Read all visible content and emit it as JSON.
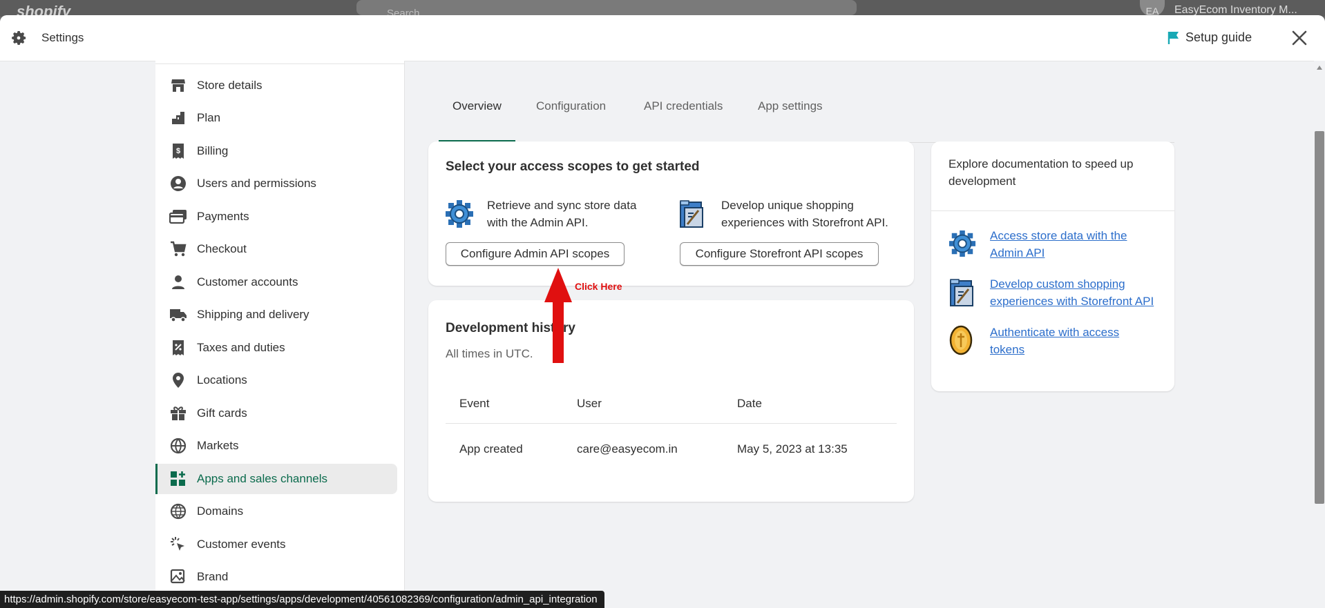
{
  "background": {
    "logo": "shopify",
    "search_placeholder": "Search",
    "avatar_initials": "EA",
    "store_name": "EasyEcom Inventory M..."
  },
  "header": {
    "title": "Settings",
    "setup_guide": "Setup guide"
  },
  "sidebar": {
    "items": [
      {
        "label": "Store details",
        "icon": "store-icon"
      },
      {
        "label": "Plan",
        "icon": "plan-icon"
      },
      {
        "label": "Billing",
        "icon": "billing-icon"
      },
      {
        "label": "Users and permissions",
        "icon": "user-circle-icon"
      },
      {
        "label": "Payments",
        "icon": "payments-icon"
      },
      {
        "label": "Checkout",
        "icon": "cart-icon"
      },
      {
        "label": "Customer accounts",
        "icon": "person-icon"
      },
      {
        "label": "Shipping and delivery",
        "icon": "truck-icon"
      },
      {
        "label": "Taxes and duties",
        "icon": "tax-icon"
      },
      {
        "label": "Locations",
        "icon": "location-pin-icon"
      },
      {
        "label": "Gift cards",
        "icon": "gift-icon"
      },
      {
        "label": "Markets",
        "icon": "markets-globe-icon"
      },
      {
        "label": "Apps and sales channels",
        "icon": "apps-icon",
        "active": true
      },
      {
        "label": "Domains",
        "icon": "globe-icon"
      },
      {
        "label": "Customer events",
        "icon": "cursor-click-icon"
      },
      {
        "label": "Brand",
        "icon": "brand-image-icon"
      }
    ]
  },
  "tabs": [
    {
      "label": "Overview",
      "active": true
    },
    {
      "label": "Configuration"
    },
    {
      "label": "API credentials"
    },
    {
      "label": "App settings"
    }
  ],
  "scopes": {
    "title": "Select your access scopes to get started",
    "admin_text_1": "Retrieve and sync store data",
    "admin_text_2": "with the Admin API.",
    "storefront_text_1": "Develop unique shopping",
    "storefront_text_2": "experiences with Storefront API.",
    "admin_button": "Configure Admin API scopes",
    "storefront_button": "Configure Storefront API scopes"
  },
  "annotation": {
    "label": "Click Here",
    "color": "#e01010"
  },
  "history": {
    "title": "Development history",
    "subtitle": "All times in UTC.",
    "columns": [
      "Event",
      "User",
      "Date"
    ],
    "rows": [
      {
        "event": "App created",
        "user": "care@easyecom.in",
        "date": "May 5, 2023 at 13:35"
      }
    ]
  },
  "docs": {
    "title_1": "Explore documentation to speed up",
    "title_2": "development",
    "links": [
      {
        "line1": "Access store data with the",
        "line2": "Admin API",
        "icon": "gear-pixel-icon"
      },
      {
        "line1": "Develop custom shopping",
        "line2": "experiences with Storefront API",
        "icon": "storefront-pixel-icon"
      },
      {
        "line1": "Authenticate with access",
        "line2": "tokens",
        "icon": "token-coin-icon"
      }
    ]
  },
  "status_url": "https://admin.shopify.com/store/easyecom-test-app/settings/apps/development/40561082369/configuration/admin_api_integration",
  "colors": {
    "accent": "#0b6b4d",
    "link": "#2c6ecb",
    "setup_flag": "#19a9b5"
  }
}
